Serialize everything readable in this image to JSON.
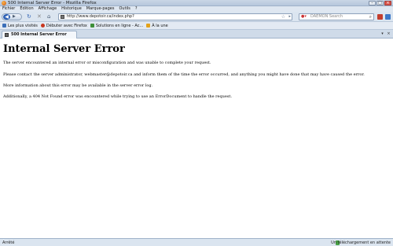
{
  "window": {
    "title": "500 Internal Server Error - Mozilla Firefox",
    "controls": [
      "–",
      "□",
      "×"
    ]
  },
  "menu": [
    "Fichier",
    "Édition",
    "Affichage",
    "Historique",
    "Marque-pages",
    "Outils",
    "?"
  ],
  "nav": {
    "url": "http://www.depotoir.ca/index.php?",
    "search_placeholder": "DAEMON Search",
    "icons": [
      "back-icon",
      "forward-icon",
      "reload-icon",
      "stop-icon",
      "home-icon"
    ]
  },
  "bookmarks": [
    {
      "label": "Les plus visités",
      "color": "#3b6fb8"
    },
    {
      "label": "Débuter avec Firefox",
      "color": "#c8371f"
    },
    {
      "label": "Solutions en ligne - Ac...",
      "color": "#3e8f3a"
    },
    {
      "label": "À la une",
      "color": "#e3a21a"
    }
  ],
  "tab": {
    "label": "500 Internal Server Error"
  },
  "page": {
    "heading": "Internal Server Error",
    "p1": "The server encountered an internal error or misconfiguration and was unable to complete your request.",
    "p2": "Please contact the server administrator, webmaster@depotoir.ca and inform them of the time the error occurred, and anything you might have done that may have caused the error.",
    "p3": "More information about this error may be available in the server error log.",
    "p4": "Additionally, a 404 Not Found error was encountered while trying to use an ErrorDocument to handle the request."
  },
  "status": {
    "left": "Arrêté",
    "right": "Un téléchargement en attente"
  }
}
